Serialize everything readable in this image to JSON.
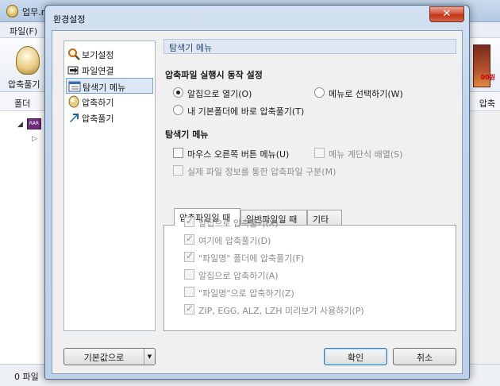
{
  "background_app": {
    "title": "업무.r",
    "menu_file": "파일(F)",
    "toolbar_compress": "압축풀기",
    "ad_text": "00원",
    "folder_label": "폴더",
    "right_column": "압축",
    "status": "0 파일"
  },
  "dialog": {
    "title": "환경설정",
    "close_glyph": "✕"
  },
  "sidebar": {
    "items": [
      {
        "label": "보기설정",
        "icon": "magnifier-icon"
      },
      {
        "label": "파일연결",
        "icon": "file-link-icon"
      },
      {
        "label": "탐색기 메뉴",
        "icon": "explorer-menu-icon"
      },
      {
        "label": "압축하기",
        "icon": "compress-icon"
      },
      {
        "label": "압축풀기",
        "icon": "extract-arrow-icon"
      }
    ],
    "selected_index": 2
  },
  "panel": {
    "header": "탐색기 메뉴",
    "run_group_title": "압축파일 실행시 동작 설정",
    "run_options": {
      "open_alzip": "알집으로 열기(O)",
      "select_menu": "메뉴로 선택하기(W)",
      "extract_to_default": "내 기본폴더에 바로 압축풀기(T)"
    },
    "explorer_group_title": "탐색기 메뉴",
    "right_click_menu": "마우스 오른쪽 버튼 메뉴(U)",
    "cascade_menu": "메뉴 계단식 배열(S)",
    "real_file_info": "실제 파일 정보를 통한 압축파일 구분(M)",
    "tabs": [
      "압축파일일 때",
      "일반파일일 때",
      "기타"
    ],
    "tab_options": [
      {
        "label": "알집으로 압축풀기(X)",
        "checked": true
      },
      {
        "label": "여기에 압축풀기(D)",
        "checked": true
      },
      {
        "label": "\"파일명\" 폴더에 압축풀기(F)",
        "checked": true
      },
      {
        "label": "알집으로 압축하기(A)",
        "checked": false
      },
      {
        "label": "\"파일명\"으로 압축하기(Z)",
        "checked": false
      },
      {
        "label": "ZIP, EGG, ALZ, LZH 미리보기 사용하기(P)",
        "checked": true
      }
    ]
  },
  "buttons": {
    "defaults": "기본값으로",
    "ok": "확인",
    "cancel": "취소"
  }
}
